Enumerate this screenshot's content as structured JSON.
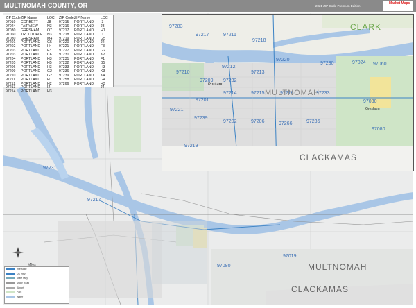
{
  "header": {
    "title": "MULTNOMAH COUNTY, OR",
    "edition": "2021 ZIP Code Premium Edition",
    "logo_text": "Market Maps"
  },
  "zip_table": {
    "headers": [
      "ZIP Code",
      "ZIP Name",
      "LOC"
    ],
    "left_rows": [
      [
        "97019",
        "CORBETT",
        "J8"
      ],
      [
        "97024",
        "FAIRVIEW",
        "N3"
      ],
      [
        "97030",
        "GRESHAM",
        "O7"
      ],
      [
        "97060",
        "TROUTDALE",
        "N3"
      ],
      [
        "97080",
        "GRESHAM",
        "M4"
      ],
      [
        "97201",
        "PORTLAND",
        "G5"
      ],
      [
        "97202",
        "PORTLAND",
        "H4"
      ],
      [
        "97203",
        "PORTLAND",
        "F3"
      ],
      [
        "97203",
        "PORTLAND",
        "C6"
      ],
      [
        "97204",
        "PORTLAND",
        "H3"
      ],
      [
        "97205",
        "PORTLAND",
        "H5"
      ],
      [
        "97206",
        "PORTLAND",
        "H3"
      ],
      [
        "97209",
        "PORTLAND",
        "G2"
      ],
      [
        "97210",
        "PORTLAND",
        "G2"
      ],
      [
        "97211",
        "PORTLAND",
        "H1"
      ],
      [
        "97212",
        "PORTLAND",
        "H2"
      ],
      [
        "97213",
        "PORTLAND",
        "I2"
      ],
      [
        "97214",
        "PORTLAND",
        "H3"
      ]
    ],
    "right_rows": [
      [
        "97215",
        "PORTLAND",
        "I3"
      ],
      [
        "97216",
        "PORTLAND",
        "J3"
      ],
      [
        "97217",
        "PORTLAND",
        "H1"
      ],
      [
        "97218",
        "PORTLAND",
        "I1"
      ],
      [
        "97219",
        "PORTLAND",
        "G5"
      ],
      [
        "97220",
        "PORTLAND",
        "J2"
      ],
      [
        "97221",
        "PORTLAND",
        "F3"
      ],
      [
        "97227",
        "PORTLAND",
        "G2"
      ],
      [
        "97230",
        "PORTLAND",
        "K2"
      ],
      [
        "97231",
        "PORTLAND",
        "F1"
      ],
      [
        "97232",
        "PORTLAND",
        "B5"
      ],
      [
        "97233",
        "PORTLAND",
        "H3"
      ],
      [
        "97236",
        "PORTLAND",
        "K3"
      ],
      [
        "97239",
        "PORTLAND",
        "K4"
      ],
      [
        "97258",
        "PORTLAND",
        "G4"
      ],
      [
        "97266",
        "PORTLAND",
        "H3"
      ],
      [
        "",
        "",
        "J4"
      ]
    ]
  },
  "inset_labels": [
    "97283",
    "97217",
    "97211",
    "97218",
    "97210",
    "97212",
    "97213",
    "97220",
    "97230",
    "97024",
    "97209",
    "97232",
    "97216",
    "97233",
    "97060",
    "97214",
    "97215",
    "97030",
    "97221",
    "97239",
    "97202",
    "97206",
    "97266",
    "97236",
    "97080",
    "97219",
    "97201",
    "Portland",
    "Gresham"
  ],
  "main_labels": [
    "97231",
    "97217",
    "97080",
    "97019",
    "MULTNOMAH",
    "CLACKAMAS",
    "CLARK"
  ],
  "inset_big": [
    "CLACKAMAS",
    "MULTNOMAH",
    "CLARK"
  ],
  "legend": {
    "rows": [
      "Interstate",
      "US Hwy",
      "State Hwy",
      "Major Road",
      "Airport",
      "Park",
      "Water"
    ],
    "scale_unit": "Miles"
  }
}
